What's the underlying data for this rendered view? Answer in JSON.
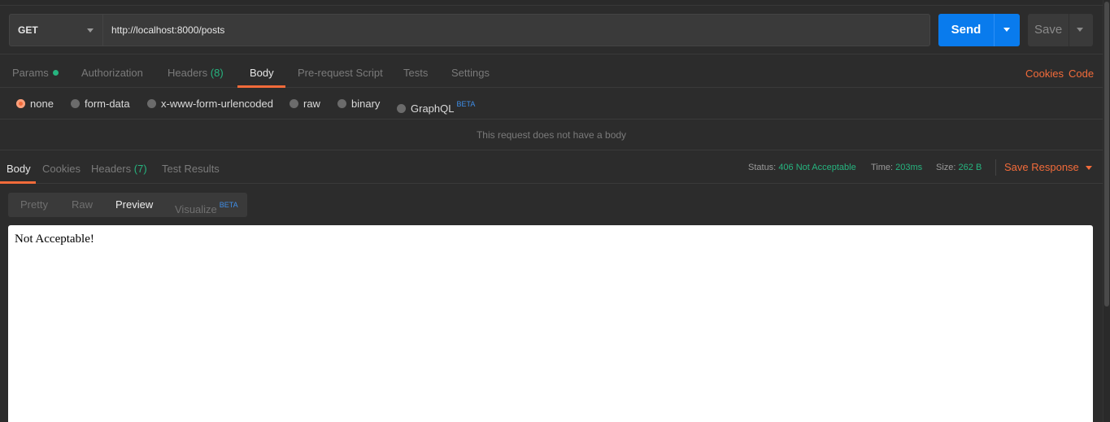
{
  "request": {
    "method": "GET",
    "url": "http://localhost:8000/posts",
    "send_label": "Send",
    "save_label": "Save"
  },
  "request_tabs": {
    "params": "Params",
    "authorization": "Authorization",
    "headers": "Headers",
    "headers_count": "(8)",
    "body": "Body",
    "pre_request_script": "Pre-request Script",
    "tests": "Tests",
    "settings": "Settings",
    "active": "Body"
  },
  "right_links": {
    "cookies": "Cookies",
    "code": "Code"
  },
  "body_types": {
    "none": "none",
    "form_data": "form-data",
    "urlencoded": "x-www-form-urlencoded",
    "raw": "raw",
    "binary": "binary",
    "graphql": "GraphQL",
    "graphql_badge": "BETA",
    "selected": "none"
  },
  "no_body_message": "This request does not have a body",
  "response_tabs": {
    "body": "Body",
    "cookies": "Cookies",
    "headers": "Headers",
    "headers_count": "(7)",
    "test_results": "Test Results",
    "active": "Body"
  },
  "response_meta": {
    "status_label": "Status:",
    "status_value": "406 Not Acceptable",
    "time_label": "Time:",
    "time_value": "203ms",
    "size_label": "Size:",
    "size_value": "262 B",
    "save_response": "Save Response"
  },
  "view_modes": {
    "pretty": "Pretty",
    "raw": "Raw",
    "preview": "Preview",
    "visualize": "Visualize",
    "visualize_badge": "BETA",
    "active": "Preview"
  },
  "preview_content": "Not Acceptable!",
  "colors": {
    "accent": "#f26b3a",
    "send": "#097bed",
    "success": "#26b47f",
    "background": "#2c2c2c"
  }
}
